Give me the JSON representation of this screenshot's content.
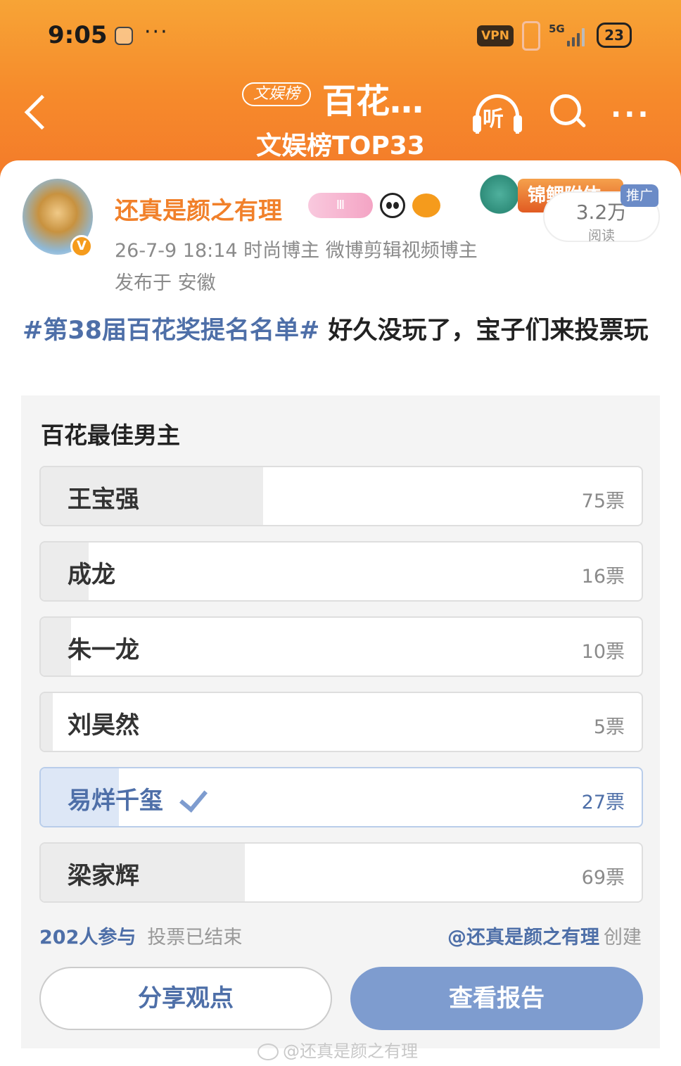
{
  "status_bar": {
    "time": "9:05",
    "dots": "···",
    "vpn": "VPN",
    "network": "5G",
    "battery": "23"
  },
  "nav": {
    "tag": "文娱榜",
    "title": "百花…",
    "subtitle": "文娱榜TOP33",
    "listen_label": "听"
  },
  "post": {
    "author": "还真是颜之有理",
    "badge_level": "Ⅲ",
    "verified": "V",
    "meta": "26-7-9 18:14  时尚博主 微博剪辑视频博主",
    "location": "发布于 安徽",
    "promo_label": "推广",
    "promo_art_text": "锦鲤附体",
    "reads_count": "3.2万",
    "reads_label": "阅读",
    "hashtag": "#第38届百花奖提名名单#",
    "text": " 好久没玩了，宝子们来投票玩"
  },
  "poll": {
    "title": "百花最佳男主",
    "options": [
      {
        "name": "王宝强",
        "votes_label": "75票",
        "votes": 75,
        "share": 0.37
      },
      {
        "name": "成龙",
        "votes_label": "16票",
        "votes": 16,
        "share": 0.08
      },
      {
        "name": "朱一龙",
        "votes_label": "10票",
        "votes": 10,
        "share": 0.05
      },
      {
        "name": "刘昊然",
        "votes_label": "5票",
        "votes": 5,
        "share": 0.02
      },
      {
        "name": "易烊千玺",
        "votes_label": "27票",
        "votes": 27,
        "share": 0.13,
        "voted": true
      },
      {
        "name": "梁家辉",
        "votes_label": "69票",
        "votes": 69,
        "share": 0.34
      }
    ],
    "participants": "202人参与",
    "status": "投票已结束",
    "creator": "@还真是颜之有理",
    "creator_suffix": "创建",
    "share_button": "分享观点",
    "report_button": "查看报告"
  },
  "watermark": "@还真是颜之有理",
  "colors": {
    "header_orange": "#f68a2b",
    "author_orange": "#f1802a",
    "link_blue": "#4e6fa8",
    "button_blue": "#7e9ccf"
  }
}
